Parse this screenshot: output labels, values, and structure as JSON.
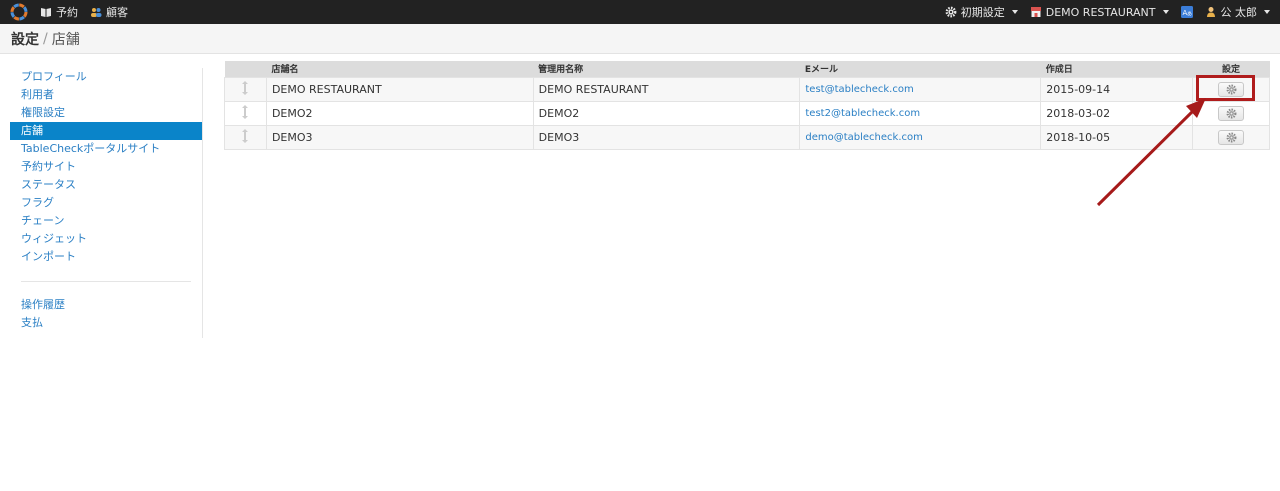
{
  "nav": {
    "left": [
      {
        "label": "予約",
        "icon": "book-icon"
      },
      {
        "label": "顧客",
        "icon": "users-icon"
      }
    ],
    "right": [
      {
        "label": "初期設定",
        "icon": "gear-icon"
      },
      {
        "label": "DEMO RESTAURANT",
        "icon": "store-icon"
      },
      {
        "label": "",
        "icon": "translate-icon"
      },
      {
        "label": "公 太郎",
        "icon": "user-icon"
      }
    ]
  },
  "header": {
    "title": "設定",
    "separator": "/",
    "subtitle": "店舗"
  },
  "sidebar": {
    "items": [
      "プロフィール",
      "利用者",
      "権限設定",
      "店舗",
      "TableCheckポータルサイト",
      "予約サイト",
      "ステータス",
      "フラグ",
      "チェーン",
      "ウィジェット",
      "インポート"
    ],
    "active": "店舗",
    "items2": [
      "操作履歴",
      "支払"
    ]
  },
  "table": {
    "columns": [
      "",
      "店舗名",
      "管理用名称",
      "Eメール",
      "作成日",
      "設定"
    ],
    "rows": [
      {
        "name": "DEMO RESTAURANT",
        "admin_name": "DEMO RESTAURANT",
        "email": "test@tablecheck.com",
        "created": "2015-09-14"
      },
      {
        "name": "DEMO2",
        "admin_name": "DEMO2",
        "email": "test2@tablecheck.com",
        "created": "2018-03-02"
      },
      {
        "name": "DEMO3",
        "admin_name": "DEMO3",
        "email": "demo@tablecheck.com",
        "created": "2018-10-05"
      }
    ]
  },
  "colors": {
    "navbar": "#222222",
    "active": "#0a84c9",
    "link": "#2a7fc4",
    "highlight": "#b01c1c"
  }
}
